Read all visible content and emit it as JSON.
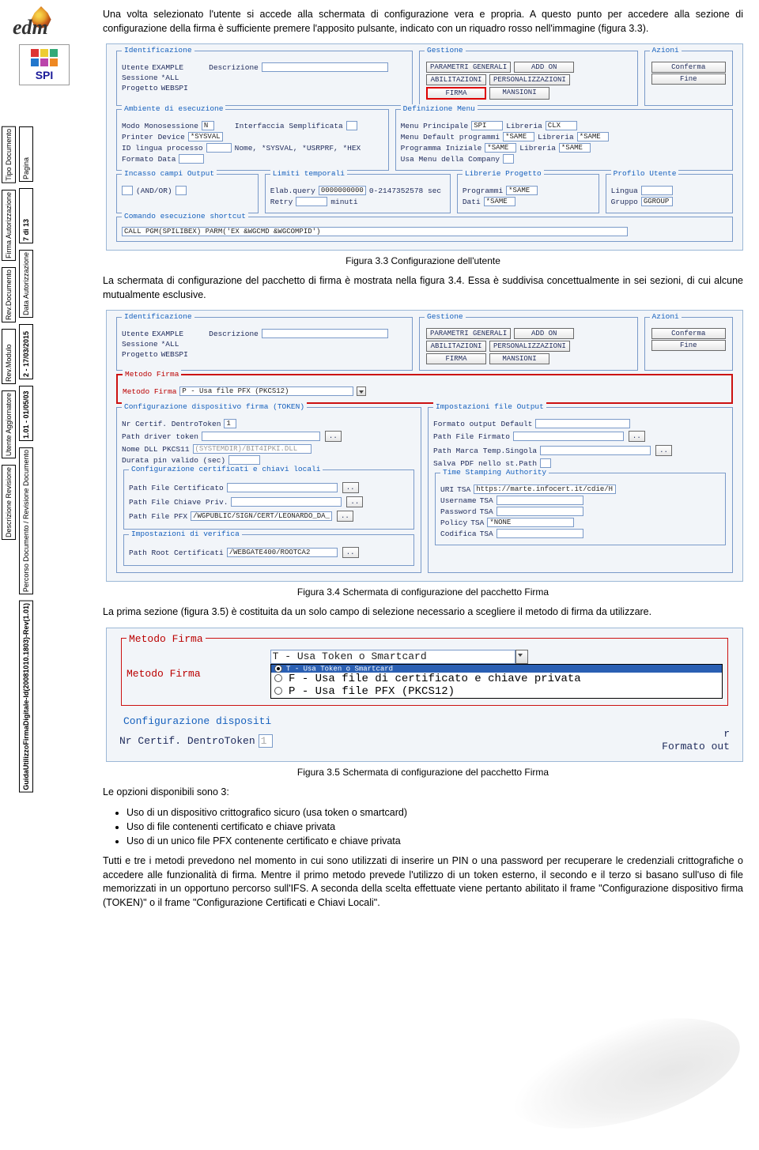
{
  "sidebar": {
    "outer": [
      {
        "label": "Tipo Documento",
        "bold": false
      },
      {
        "label": "Firma Autorizzazione",
        "bold": false
      },
      {
        "label": "Rev.Documento",
        "bold": false
      },
      {
        "label": "Rev.Modulo",
        "bold": false
      },
      {
        "label": "Utente Aggiornatore",
        "bold": false
      },
      {
        "label": "Descrizione Revisione",
        "bold": false
      }
    ],
    "inner": [
      {
        "label": "Pagina",
        "bold": false
      },
      {
        "label": "7 di 13",
        "bold": true
      },
      {
        "label": "Data Autorizzazione",
        "bold": false
      },
      {
        "label": "2 - 17/03/2015",
        "bold": true
      },
      {
        "label": "1.01 - 01/05/03",
        "bold": true
      },
      {
        "label": "Percorso Documento / Revisione Documento",
        "bold": false
      },
      {
        "label": "GuidaUtilizzoFirmaDigitale-Id(20081010.1803)-Rev(1.01)",
        "bold": true
      }
    ],
    "logo": {
      "text": "edm",
      "sub": "SPI"
    }
  },
  "paragraphs": {
    "p1": "Una volta selezionato l'utente si accede alla schermata di configurazione vera e propria. A questo punto per accedere alla sezione di configurazione della firma è sufficiente premere l'apposito pulsante, indicato con un riquadro rosso nell'immagine (figura 3.3).",
    "p2": "La schermata di configurazione del pacchetto di firma è mostrata nella figura 3.4. Essa è suddivisa concettualmente in sei sezioni, di cui alcune mutualmente esclusive.",
    "p3": "La prima sezione (figura 3.5) è costituita da un solo campo di selezione necessario a scegliere il metodo di firma da utilizzare.",
    "p4_intro": "Le opzioni disponibili sono 3:",
    "p4_bullets": [
      "Uso di un dispositivo crittografico sicuro (usa token o smartcard)",
      "Uso di file contenenti certificato e chiave privata",
      "Uso di un unico file PFX contenente certificato e chiave privata"
    ],
    "p5": "Tutti e tre i metodi prevedono nel momento in cui sono utilizzati di inserire un PIN o una password per recuperare le credenziali crittografiche o accedere alle funzionalità di firma. Mentre il primo metodo prevede l'utilizzo di un token esterno, il secondo e il terzo si basano sull'uso di file memorizzati in un opportuno percorso sull'IFS. A seconda della scelta effettuate viene pertanto abilitato il frame \"Configurazione dispositivo firma (TOKEN)\" o il frame \"Configurazione Certificati e Chiavi Locali\"."
  },
  "captions": {
    "c33": "Figura 3.3 Configurazione dell'utente",
    "c34": "Figura 3.4 Schermata di configurazione del pacchetto Firma",
    "c35": "Figura 3.5 Schermata di configurazione del pacchetto Firma"
  },
  "shot33": {
    "ident_legend": "Identificazione",
    "utente": "Utente",
    "utente_v": "EXAMPLE",
    "descrizione": "Descrizione",
    "sessione": "Sessione",
    "sessione_v": "*ALL",
    "progetto": "Progetto",
    "progetto_v": "WEBSPI",
    "gestione_legend": "Gestione",
    "gestione": [
      "PARAMETRI GENERALI",
      "ADD ON",
      "ABILITAZIONI",
      "PERSONALIZZAZIONI",
      "FIRMA",
      "MANSIONI"
    ],
    "gestione_highlight": 4,
    "azioni_legend": "Azioni",
    "azioni": [
      "Conferma",
      "Fine"
    ],
    "ambiente_legend": "Ambiente di esecuzione",
    "ambiente": {
      "modo": "Modo Monosessione",
      "modo_v": "N",
      "interfaccia": "Interfaccia Semplificata",
      "printer": "Printer Device",
      "printer_v": "*SYSVAL",
      "idling": "ID lingua processo",
      "nome": "Nome, *SYSVAL, *USRPRF, *HEX",
      "formato": "Formato Data"
    },
    "defmenu_legend": "Definizione Menu",
    "defmenu": {
      "menu_principale": "Menu Principale",
      "menu_principale_v": "SPI",
      "lib1": "Libreria",
      "lib1_v": "CLX",
      "menu_default": "Menu Default programmi",
      "menu_default_v": "*SAME",
      "lib2": "Libreria",
      "lib2_v": "*SAME",
      "prog_iniz": "Programma Iniziale",
      "prog_iniz_v": "*SAME",
      "lib3": "Libreria",
      "lib3_v": "*SAME",
      "usa_menu": "Usa Menu della Company"
    },
    "incasso_legend": "Incasso campi Output",
    "incasso": "(AND/OR)",
    "limiti_legend": "Limiti temporali",
    "limiti": {
      "elab": "Elab.query",
      "elab_v": "0000000000",
      "elab_v2": "0-2147352578 sec",
      "retry": "Retry",
      "retry_u": "minuti"
    },
    "librerie_legend": "Librerie Progetto",
    "librerie": {
      "programmi": "Programmi",
      "programmi_v": "*SAME",
      "dati": "Dati",
      "dati_v": "*SAME"
    },
    "profilo_legend": "Profilo Utente",
    "profilo": {
      "lingua": "Lingua",
      "gruppo": "Gruppo",
      "gruppo_v": "GGROUP"
    },
    "comando_legend": "Comando esecuzione shortcut",
    "comando_v": "CALL PGM(SPILIBEX) PARM('EX &WGCMD &WGCOMPID')"
  },
  "shot34": {
    "ident_legend": "Identificazione",
    "gestione_legend": "Gestione",
    "azioni_legend": "Azioni",
    "gestione": [
      "PARAMETRI GENERALI",
      "ADD ON",
      "ABILITAZIONI",
      "PERSONALIZZAZIONI",
      "FIRMA",
      "MANSIONI"
    ],
    "azioni": [
      "Conferma",
      "Fine"
    ],
    "utente": "Utente",
    "utente_v": "EXAMPLE",
    "descrizione": "Descrizione",
    "sessione": "Sessione",
    "sessione_v": "*ALL",
    "progetto": "Progetto",
    "progetto_v": "WEBSPI",
    "metodo_legend": "Metodo Firma",
    "metodo_l": "Metodo Firma",
    "metodo_v": "P - Usa file PFX (PKCS12)",
    "cfgtoken_legend": "Configurazione dispositivo firma (TOKEN)",
    "cfgtoken": {
      "nr": "Nr Certif. DentroToken",
      "nr_v": "1",
      "driver": "Path driver token",
      "dll": "Nome DLL PKCS11",
      "dll_v": "(SYSTEMDIR)/BIT4IPKI.DLL",
      "durata": "Durata pin valido (sec)"
    },
    "cfgcert_legend": "Configurazione certificati e chiavi locali",
    "cfgcert": {
      "pcert": "Path File Certificato",
      "pchiave": "Path File Chiave Priv.",
      "ppfx": "Path File PFX",
      "ppfx_v": "/WGPUBLIC/SIGN/CERT/LEONARDO_DA_"
    },
    "impver_legend": "Impostazioni di verifica",
    "proot": "Path Root Certificati",
    "proot_v": "/WEBGATE400/ROOTCA2",
    "impout_legend": "Impostazioni file Output",
    "impout": {
      "fout": "Formato output Default",
      "pf": "Path File Firmato",
      "pms": "Path Marca Temp.Singola",
      "salva": "Salva PDF nello st.Path"
    },
    "tsa_legend": "Time Stamping Authority",
    "tsa": {
      "uri_l": "URI",
      "tsa_l": "TSA",
      "uri_v": "https://marte.infocert.it/cdie/H",
      "user": "Username",
      "user_tsa": "TSA",
      "pwd": "Password",
      "pwd_tsa": "TSA",
      "pol": "Policy",
      "pol_tsa": "TSA",
      "pol_v": "*NONE",
      "cod": "Codifica",
      "cod_tsa": "TSA"
    }
  },
  "shot35": {
    "metodo_legend": "Metodo Firma",
    "metodo_l": "Metodo Firma",
    "dd_current": "T - Usa Token o Smartcard",
    "dd_options": [
      "T - Usa Token o Smartcard",
      "F - Usa file di certificato e chiave privata",
      "P - Usa file PFX (PKCS12)"
    ],
    "dd_selected_index": 0,
    "below_left": "Configurazione dispositi",
    "nr": "Nr Certif. DentroToken",
    "nr_v": "1",
    "right_hint": "r",
    "right_label": "Formato out"
  }
}
